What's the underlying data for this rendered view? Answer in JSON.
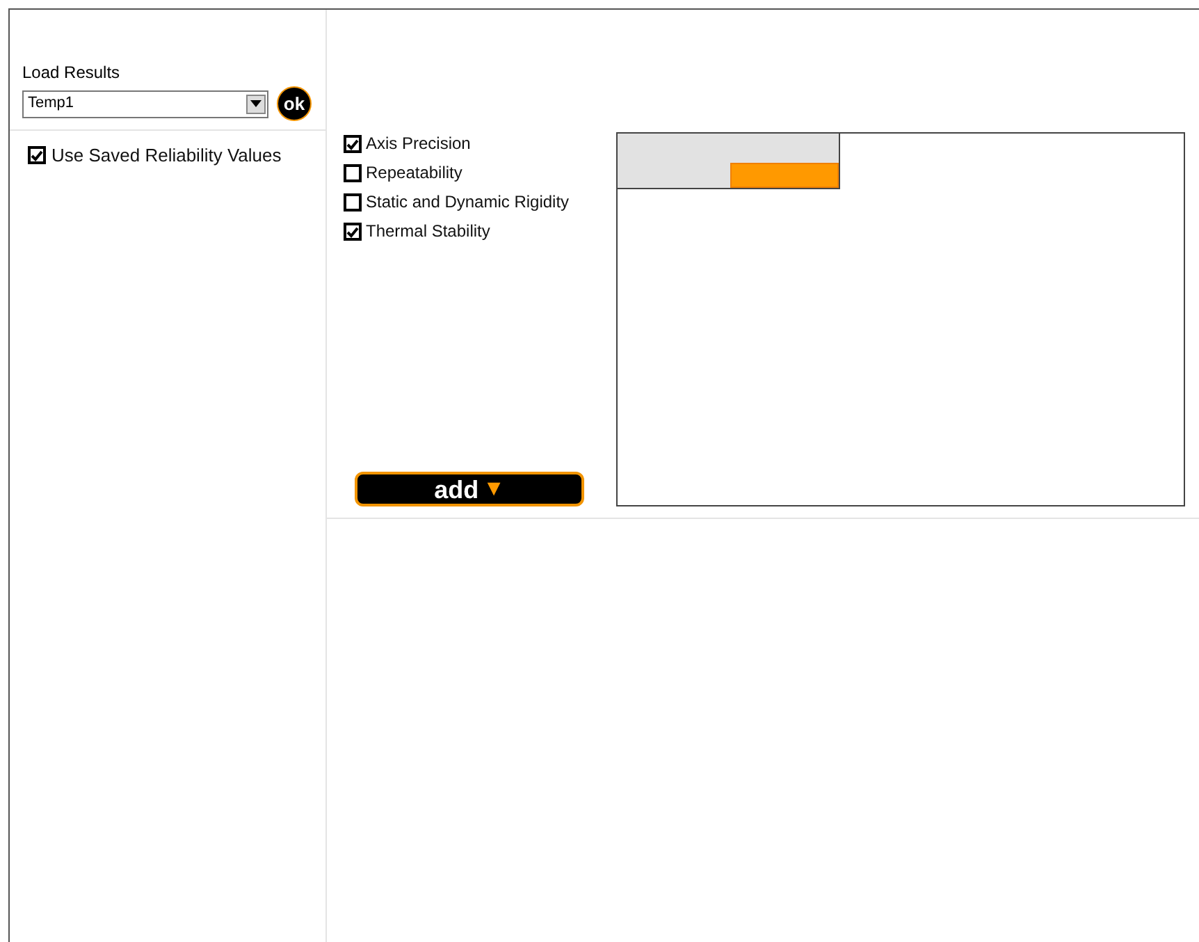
{
  "load_results": {
    "label": "Load Results",
    "value": "Temp1",
    "ok_button": "ok"
  },
  "use_saved": {
    "label": "Use Saved Reliability Values",
    "checked": true
  },
  "categories": [
    {
      "label": "Axis Precision",
      "checked": true
    },
    {
      "label": "Repeatability",
      "checked": false
    },
    {
      "label": "Static and Dynamic Rigidity",
      "checked": false
    },
    {
      "label": "Thermal Stability",
      "checked": true
    }
  ],
  "add_button": {
    "label": "add",
    "arrow": "▼"
  }
}
